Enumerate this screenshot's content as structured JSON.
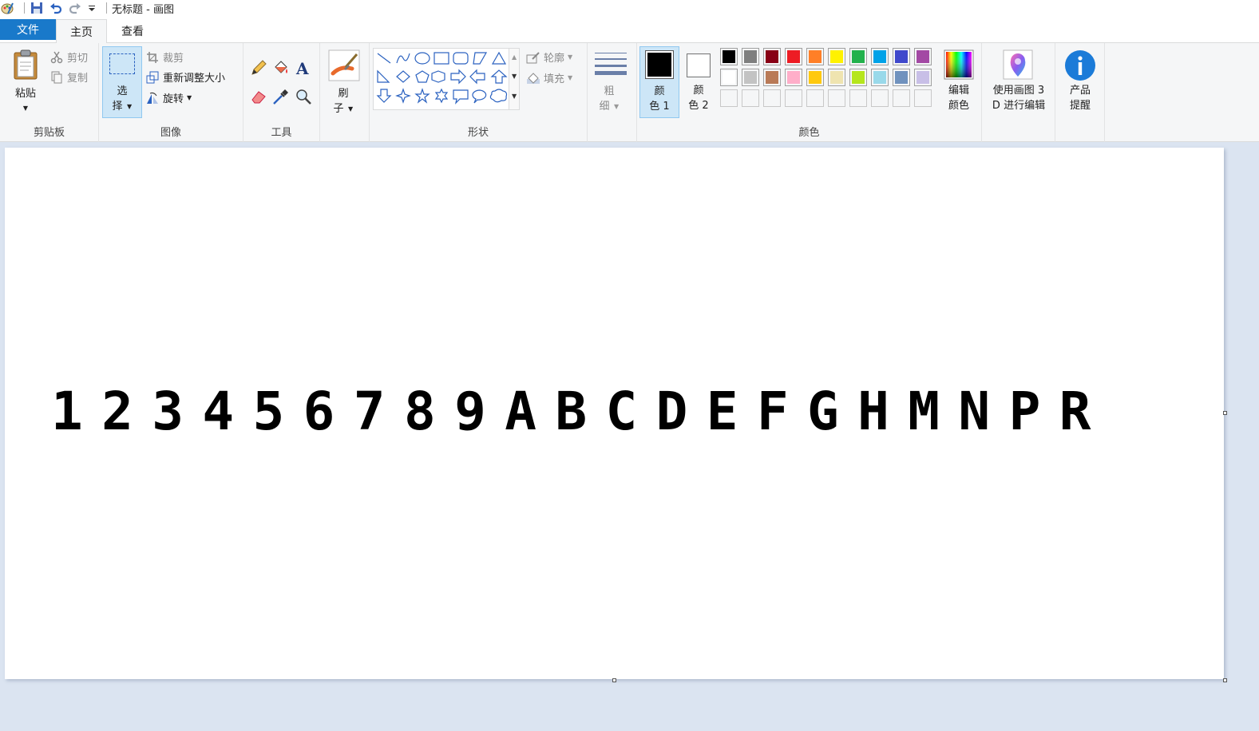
{
  "titlebar": {
    "title": "无标题 - 画图",
    "qa_icons": [
      "paint-app-icon",
      "save-icon",
      "undo-icon",
      "redo-icon",
      "customize-dropdown-icon"
    ]
  },
  "tabs": {
    "file": "文件",
    "home": "主页",
    "view": "查看"
  },
  "clipboard": {
    "paste_label": "粘贴",
    "cut_label": "剪切",
    "copy_label": "复制",
    "group_label": "剪贴板"
  },
  "image": {
    "select_line1": "选",
    "select_line2": "择",
    "crop_label": "裁剪",
    "resize_label": "重新调整大小",
    "rotate_label": "旋转",
    "group_label": "图像"
  },
  "tools": {
    "group_label": "工具"
  },
  "brushes": {
    "line1": "刷",
    "line2": "子"
  },
  "shapes": {
    "outline_label": "轮廓",
    "fill_label": "填充",
    "group_label": "形状"
  },
  "size": {
    "line1": "粗",
    "line2": "细"
  },
  "colors": {
    "color1_line1": "颜",
    "color1_line2": "色 1",
    "color2_line1": "颜",
    "color2_line2": "色 2",
    "color1_value": "#000000",
    "color2_value": "#ffffff",
    "edit_line1": "编辑",
    "edit_line2": "颜色",
    "group_label": "颜色",
    "palette_row1": [
      "#000000",
      "#7f7f7f",
      "#880015",
      "#ed1c24",
      "#ff7f27",
      "#fff200",
      "#22b14c",
      "#00a2e8",
      "#3f48cc",
      "#a349a4"
    ],
    "palette_row2": [
      "#ffffff",
      "#c3c3c3",
      "#b97a57",
      "#ffaec9",
      "#ffc90e",
      "#efe4b0",
      "#b5e61d",
      "#99d9ea",
      "#7092be",
      "#c8bfe7"
    ]
  },
  "paint3d": {
    "line1": "使用画图 3",
    "line2": "D 进行编辑"
  },
  "product": {
    "line1": "产品",
    "line2": "提醒"
  },
  "canvas": {
    "text": "123456789ABCDEFGHMNPR"
  }
}
